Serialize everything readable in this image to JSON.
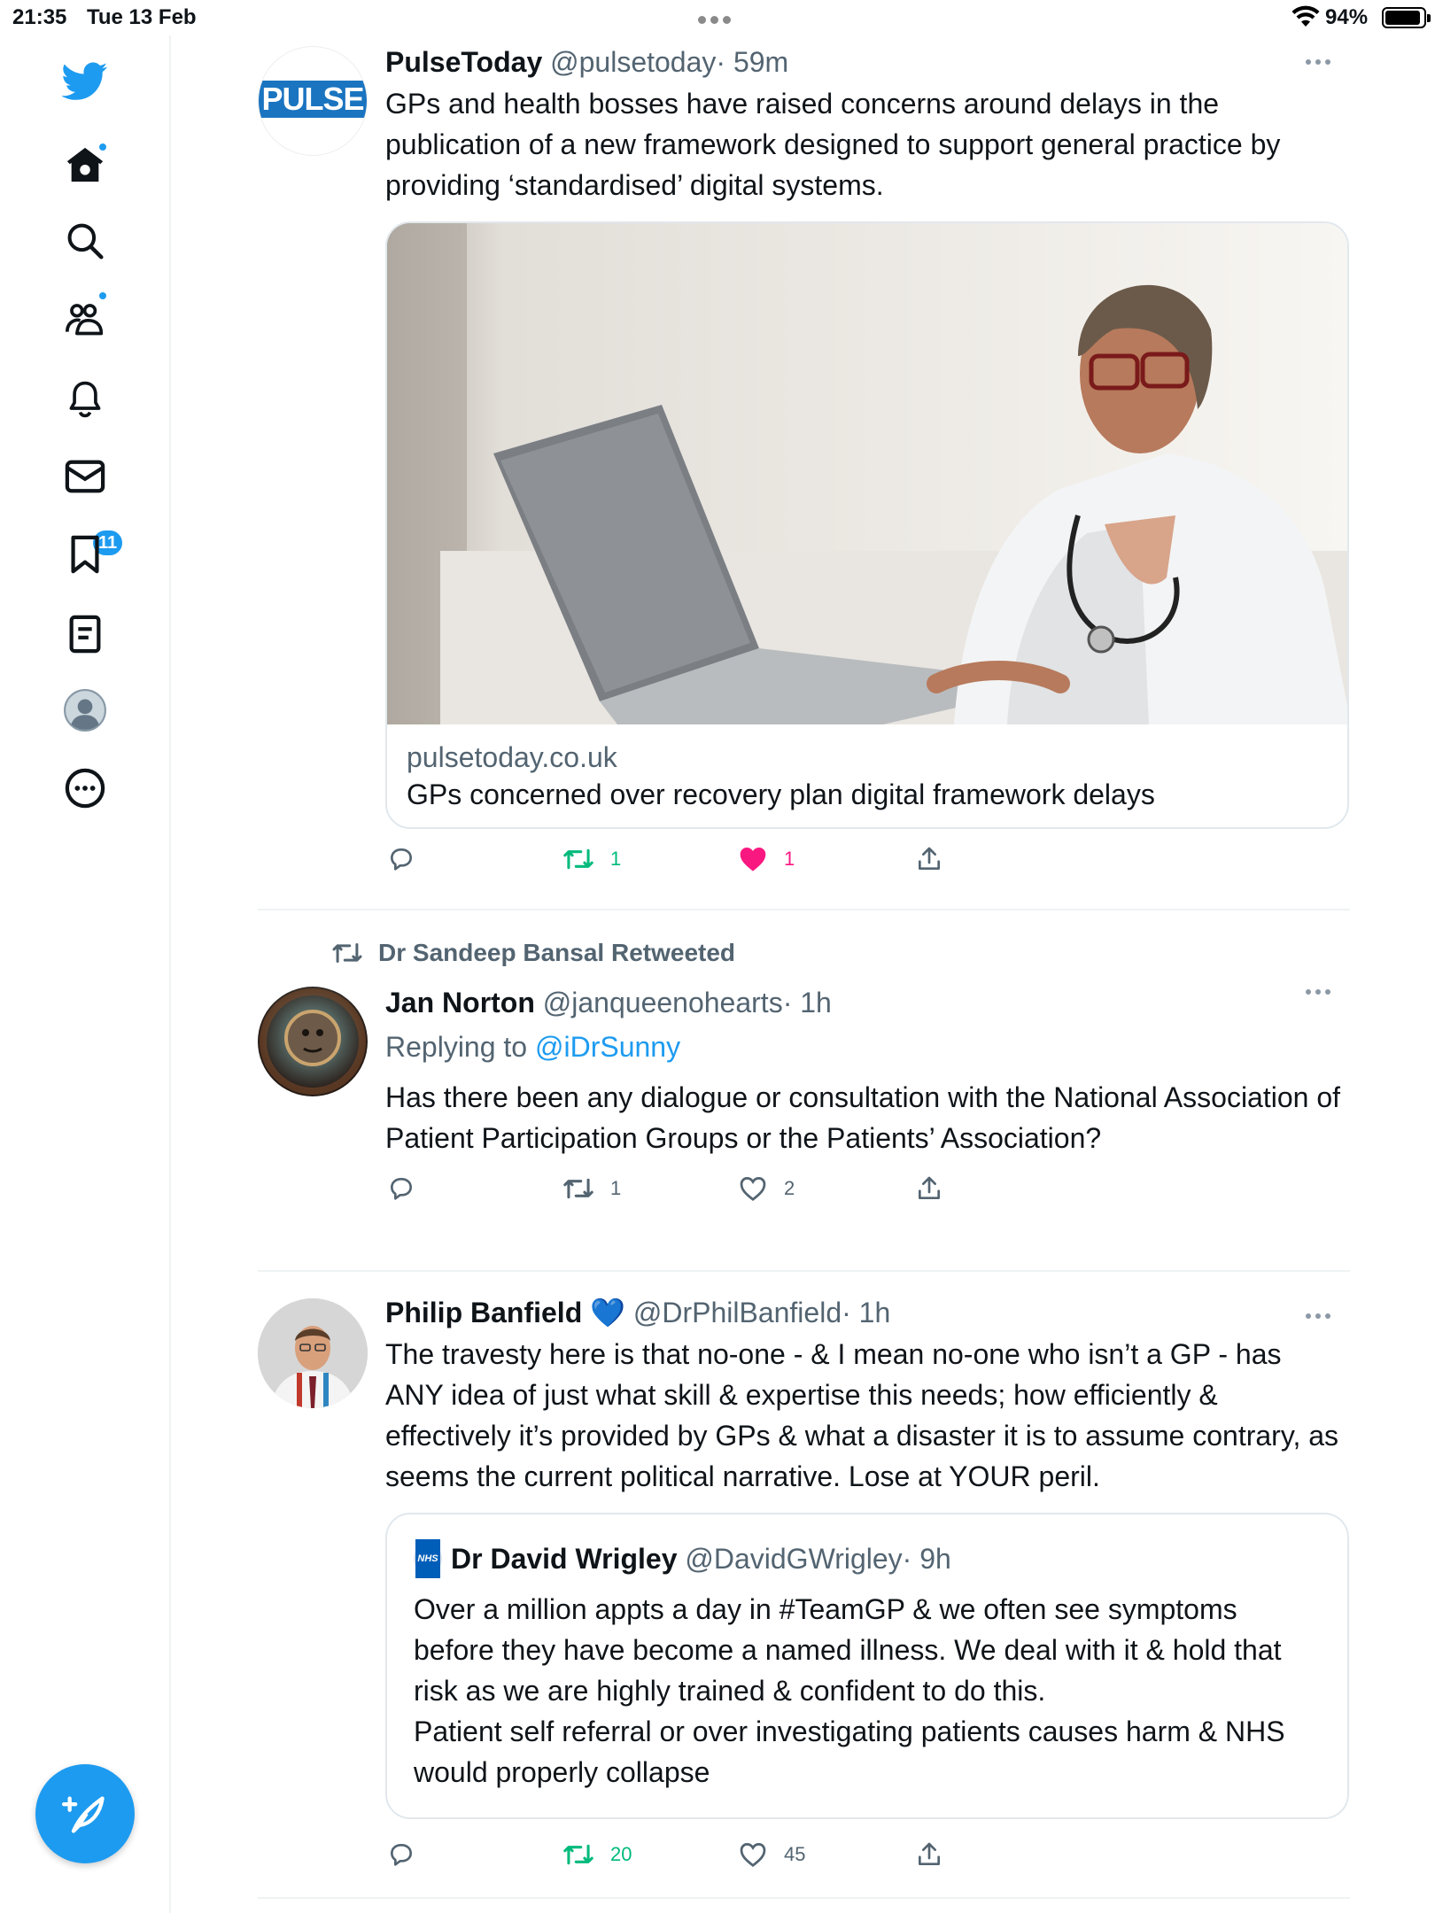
{
  "status_bar": {
    "time": "21:35",
    "date": "Tue 13 Feb",
    "battery": "94%",
    "battery_level": 0.94
  },
  "sidebar": {
    "items": [
      {
        "icon": "twitter-bird-icon"
      },
      {
        "icon": "home-icon",
        "has_dot": true
      },
      {
        "icon": "search-icon"
      },
      {
        "icon": "communities-icon",
        "has_dot": true
      },
      {
        "icon": "notifications-bell-icon",
        "badge": "11"
      },
      {
        "icon": "messages-envelope-icon"
      },
      {
        "icon": "bookmark-icon"
      },
      {
        "icon": "lists-icon"
      },
      {
        "icon": "profile-avatar-icon"
      },
      {
        "icon": "more-circle-icon"
      }
    ],
    "compose_icon": "compose-feather-icon",
    "accent_color": "#1d9bf0"
  },
  "tweets": [
    {
      "name": "PulseToday",
      "handle": "@pulsetoday",
      "time": "· 59m",
      "avatar_text": "PULSE",
      "text": "GPs and health bosses have raised concerns around delays in the publication of a new framework designed to support general practice by providing ‘standardised’ digital systems.",
      "card": {
        "domain": "pulsetoday.co.uk",
        "title": "GPs concerned over recovery plan digital framework delays"
      },
      "retweets": "1",
      "likes": "1"
    },
    {
      "retweeted_by": "Dr Sandeep Bansal Retweeted",
      "name": "Jan Norton",
      "handle": "@janqueenohearts",
      "time": "· 1h",
      "replying_prefix": "Replying to ",
      "replying_to": "@iDrSunny",
      "text": "Has there been any dialogue or consultation with the National Association of Patient Participation Groups or the Patients’ Association?",
      "retweets": "1",
      "likes": "2"
    },
    {
      "name": "Philip Banfield",
      "verified_emoji": "💙",
      "handle": "@DrPhilBanfield",
      "time": "· 1h",
      "text": "The travesty here is that no-one - & I mean no-one who isn’t a GP - has ANY idea of just what skill & expertise this needs; how efficiently & effectively it’s provided by GPs & what a disaster it is to assume contrary, as seems the current political narrative. Lose at YOUR peril.",
      "quote": {
        "avatar_text": "NHS",
        "name": "Dr David Wrigley",
        "handle": "@DavidGWrigley",
        "time": "· 9h",
        "text_lines": [
          "Over a million appts a day in #TeamGP & we often see symptoms before they have become a named illness. We deal with it & hold that risk as we are highly trained & confident to do this.",
          "Patient self referral or over investigating patients causes harm & NHS would properly collapse"
        ]
      },
      "retweets": "20",
      "likes": "45"
    }
  ]
}
